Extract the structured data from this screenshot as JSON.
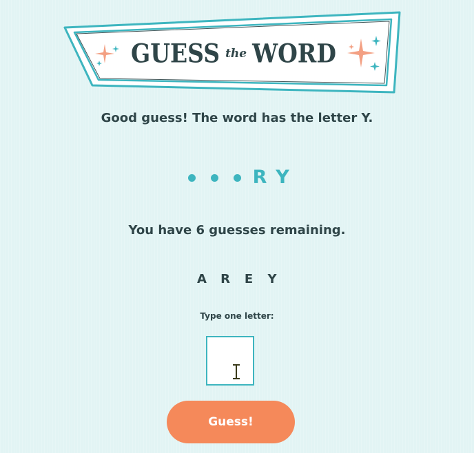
{
  "banner": {
    "word_1": "GUESS",
    "word_the": "the",
    "word_2": "WORD"
  },
  "feedback": "Good guess! The word has the letter Y.",
  "word_slots": [
    "",
    "",
    "",
    "R",
    "Y"
  ],
  "remaining": "You have 6 guesses remaining.",
  "guessed_letters": [
    "A",
    "R",
    "E",
    "Y"
  ],
  "input": {
    "label": "Type one letter:",
    "value": ""
  },
  "guess_button": "Guess!",
  "colors": {
    "background": "#e2f4f4",
    "teal": "#3db5bf",
    "text": "#2f4548",
    "button": "#f5895a",
    "sparkle_orange": "#f3a083"
  }
}
